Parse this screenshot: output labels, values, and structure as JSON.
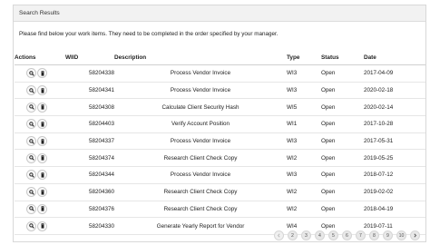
{
  "panel": {
    "title": "Search Results",
    "instructions": "Please find below your work items. They need to be completed in the order specified by your manager."
  },
  "table": {
    "headers": {
      "actions": "Actions",
      "wiid": "WIID",
      "description": "Description",
      "type": "Type",
      "status": "Status",
      "date": "Date"
    },
    "rows": [
      {
        "wiid": "58204338",
        "description": "Process Vendor Invoice",
        "type": "WI3",
        "status": "Open",
        "date": "2017-04-09"
      },
      {
        "wiid": "58204341",
        "description": "Process Vendor Invoice",
        "type": "WI3",
        "status": "Open",
        "date": "2020-02-18"
      },
      {
        "wiid": "58204308",
        "description": "Calculate Client Security Hash",
        "type": "WI5",
        "status": "Open",
        "date": "2020-02-14"
      },
      {
        "wiid": "58204403",
        "description": "Verify Account Position",
        "type": "WI1",
        "status": "Open",
        "date": "2017-10-28"
      },
      {
        "wiid": "58204337",
        "description": "Process Vendor Invoice",
        "type": "WI3",
        "status": "Open",
        "date": "2017-05-31"
      },
      {
        "wiid": "58204374",
        "description": "Research Client Check Copy",
        "type": "WI2",
        "status": "Open",
        "date": "2019-05-25"
      },
      {
        "wiid": "58204344",
        "description": "Process Vendor Invoice",
        "type": "WI3",
        "status": "Open",
        "date": "2018-07-12"
      },
      {
        "wiid": "58204360",
        "description": "Research Client Check Copy",
        "type": "WI2",
        "status": "Open",
        "date": "2019-02-02"
      },
      {
        "wiid": "58204376",
        "description": "Research Client Check Copy",
        "type": "WI2",
        "status": "Open",
        "date": "2018-04-19"
      },
      {
        "wiid": "58204330",
        "description": "Generate Yearly Report for Vendor",
        "type": "WI4",
        "status": "Open",
        "date": "2019-07-11"
      }
    ],
    "row_actions": {
      "view_icon": "search-icon",
      "delete_icon": "trash-icon"
    }
  },
  "pagination": {
    "prev_icon": "chevron-left-icon",
    "pages": [
      "2",
      "3",
      "4",
      "5",
      "6",
      "7",
      "8",
      "9",
      "10"
    ],
    "next_icon": "chevron-right-icon"
  }
}
